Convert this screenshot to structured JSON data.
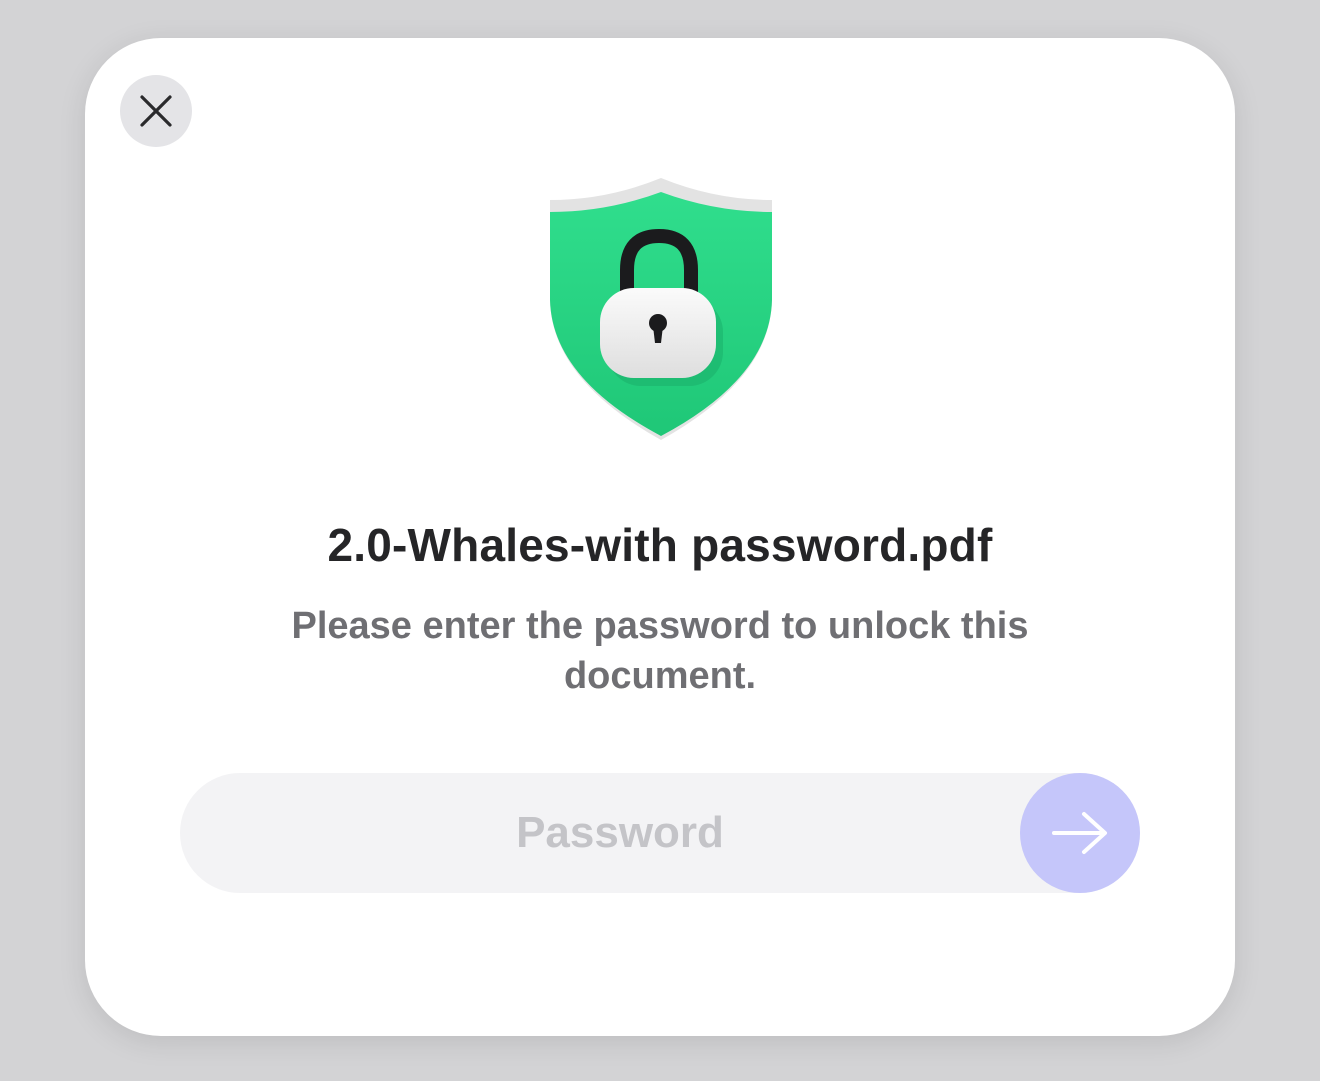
{
  "dialog": {
    "filename": "2.0-Whales-with password.pdf",
    "message": "Please enter the password to unlock this document.",
    "password_placeholder": "Password",
    "password_value": "",
    "icons": {
      "close": "close-icon",
      "shield": "shield-lock-icon",
      "submit": "arrow-right-icon"
    },
    "colors": {
      "shield_green": "#2bd684",
      "submit_button": "#c5c6fa",
      "field_background": "#f3f3f5",
      "close_button": "#e4e4e7"
    }
  }
}
